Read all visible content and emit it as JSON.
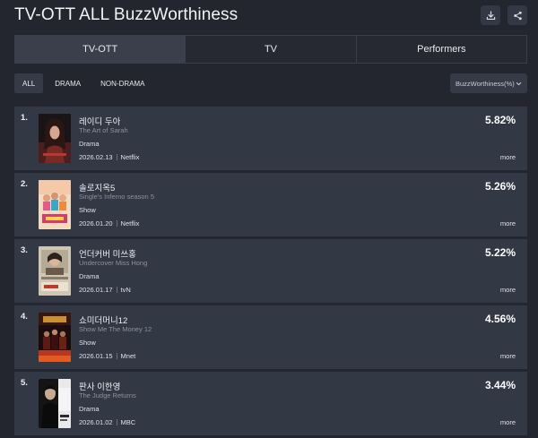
{
  "header": {
    "title": "TV-OTT ALL BuzzWorthiness",
    "download_icon": "download-icon",
    "share_icon": "share-icon"
  },
  "tabs": [
    {
      "label": "TV-OTT",
      "active": true
    },
    {
      "label": "TV",
      "active": false
    },
    {
      "label": "Performers",
      "active": false
    }
  ],
  "filters": [
    {
      "label": "ALL",
      "active": true
    },
    {
      "label": "DRAMA",
      "active": false
    },
    {
      "label": "NON-DRAMA",
      "active": false
    }
  ],
  "sort": {
    "label": "BuzzWorthiness(%)",
    "icon": "chevron-down-icon"
  },
  "rankings": [
    {
      "rank": "1.",
      "title": "레이디 두아",
      "subtitle": "The Art of Sarah",
      "genre": "Drama",
      "date": "2026.02.13",
      "channel": "Netflix",
      "percent": "5.82%",
      "more": "more"
    },
    {
      "rank": "2.",
      "title": "솔로지옥5",
      "subtitle": "Single's Inferno season 5",
      "genre": "Show",
      "date": "2026.01.20",
      "channel": "Netflix",
      "percent": "5.26%",
      "more": "more"
    },
    {
      "rank": "3.",
      "title": "언더커버 미쓰홍",
      "subtitle": "Undercover Miss Hong",
      "genre": "Drama",
      "date": "2026.01.17",
      "channel": "tvN",
      "percent": "5.22%",
      "more": "more"
    },
    {
      "rank": "4.",
      "title": "쇼미더머니12",
      "subtitle": "Show Me The Money 12",
      "genre": "Show",
      "date": "2026.01.15",
      "channel": "Mnet",
      "percent": "4.56%",
      "more": "more"
    },
    {
      "rank": "5.",
      "title": "판사 이한영",
      "subtitle": "The Judge Returns",
      "genre": "Drama",
      "date": "2026.01.02",
      "channel": "MBC",
      "percent": "3.44%",
      "more": "more"
    }
  ]
}
